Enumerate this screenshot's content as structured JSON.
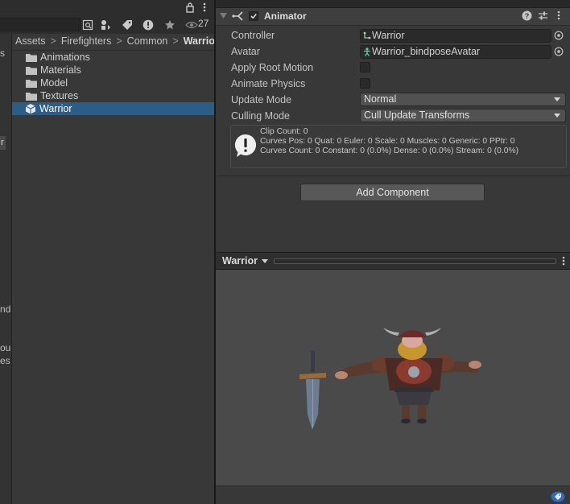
{
  "project": {
    "toolbar": {
      "hidden_count": "27"
    },
    "tree_fragments": [
      "s",
      "r",
      "nd",
      "ou",
      "es"
    ],
    "breadcrumb": [
      "Assets",
      "Firefighters",
      "Common",
      "Warrior"
    ],
    "items": [
      {
        "label": "Animations",
        "type": "folder",
        "selected": false
      },
      {
        "label": "Materials",
        "type": "folder",
        "selected": false
      },
      {
        "label": "Model",
        "type": "folder",
        "selected": false
      },
      {
        "label": "Textures",
        "type": "folder",
        "selected": false
      },
      {
        "label": "Warrior",
        "type": "prefab",
        "selected": true
      }
    ]
  },
  "inspector": {
    "component": {
      "title": "Animator",
      "enabled": true
    },
    "properties": {
      "controller_label": "Controller",
      "controller_value": "Warrior",
      "avatar_label": "Avatar",
      "avatar_value": "Warrior_bindposeAvatar",
      "apply_root_motion_label": "Apply Root Motion",
      "apply_root_motion": false,
      "animate_physics_label": "Animate Physics",
      "animate_physics": false,
      "update_mode_label": "Update Mode",
      "update_mode_value": "Normal",
      "culling_mode_label": "Culling Mode",
      "culling_mode_value": "Cull Update Transforms"
    },
    "info": {
      "line1": "Clip Count: 0",
      "line2": "Curves Pos: 0 Quat: 0 Euler: 0 Scale: 0 Muscles: 0 Generic: 0 PPtr: 0",
      "line3": "Curves Count: 0 Constant: 0 (0.0%) Dense: 0 (0.0%) Stream: 0 (0.0%)"
    },
    "add_component_label": "Add Component"
  },
  "preview": {
    "name": "Warrior"
  },
  "colors": {
    "selection": "#2c5d87",
    "panel": "#383838",
    "preview_bg": "#4a4a4a",
    "accent_blue": "#3b78c8"
  }
}
